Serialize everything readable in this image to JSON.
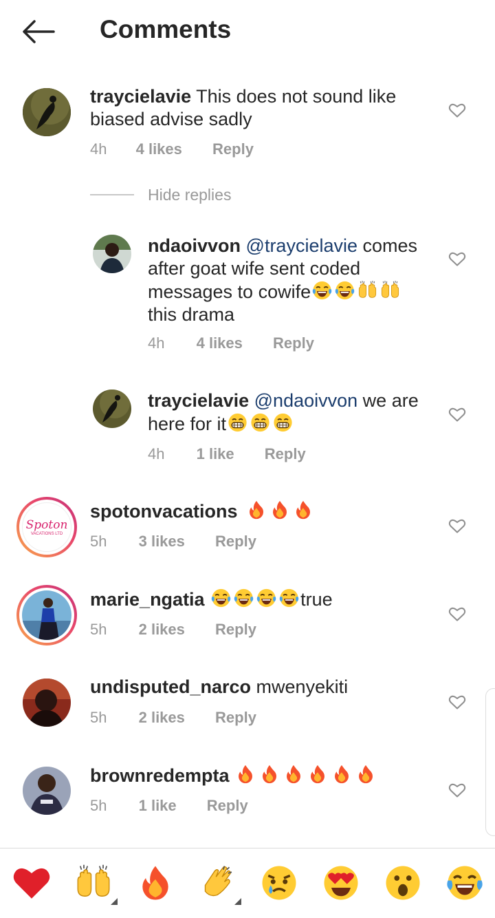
{
  "header": {
    "title": "Comments"
  },
  "hide_replies_label": "Hide replies",
  "comments": [
    {
      "username": "traycielavie",
      "text": "This does not sound like biased advise sadly",
      "time": "4h",
      "likes": "4 likes",
      "reply": "Reply"
    },
    {
      "username": "ndaoivvon",
      "mention": "@traycielavie",
      "text": "comes after goat wife sent coded messages to cowife",
      "text_after": "this drama",
      "time": "4h",
      "likes": "4 likes",
      "reply": "Reply"
    },
    {
      "username": "traycielavie",
      "mention": "@ndaoivvon",
      "text": "we are here for it",
      "time": "4h",
      "likes": "1 like",
      "reply": "Reply"
    },
    {
      "username": "spotonvacations",
      "text": "",
      "time": "5h",
      "likes": "3 likes",
      "reply": "Reply",
      "avatar_text": "Spoton",
      "avatar_subtext": "VACATIONS LTD"
    },
    {
      "username": "marie_ngatia",
      "text": "true",
      "time": "5h",
      "likes": "2 likes",
      "reply": "Reply"
    },
    {
      "username": "undisputed_narco",
      "text": "mwenyekiti",
      "time": "5h",
      "likes": "2 likes",
      "reply": "Reply"
    },
    {
      "username": "brownredempta",
      "text": "",
      "time": "5h",
      "likes": "1 like",
      "reply": "Reply"
    }
  ],
  "reactions": [
    "red-heart",
    "raising-hands",
    "fire",
    "clapping-hands",
    "sad-tear-face",
    "heart-eyes-face",
    "astonished-face",
    "tears-of-joy-face"
  ],
  "colors": {
    "text": "#262626",
    "meta": "#999999",
    "mention": "#1b3d6d",
    "story_ring_start": "#f9a84a",
    "story_ring_end": "#c4327a"
  }
}
